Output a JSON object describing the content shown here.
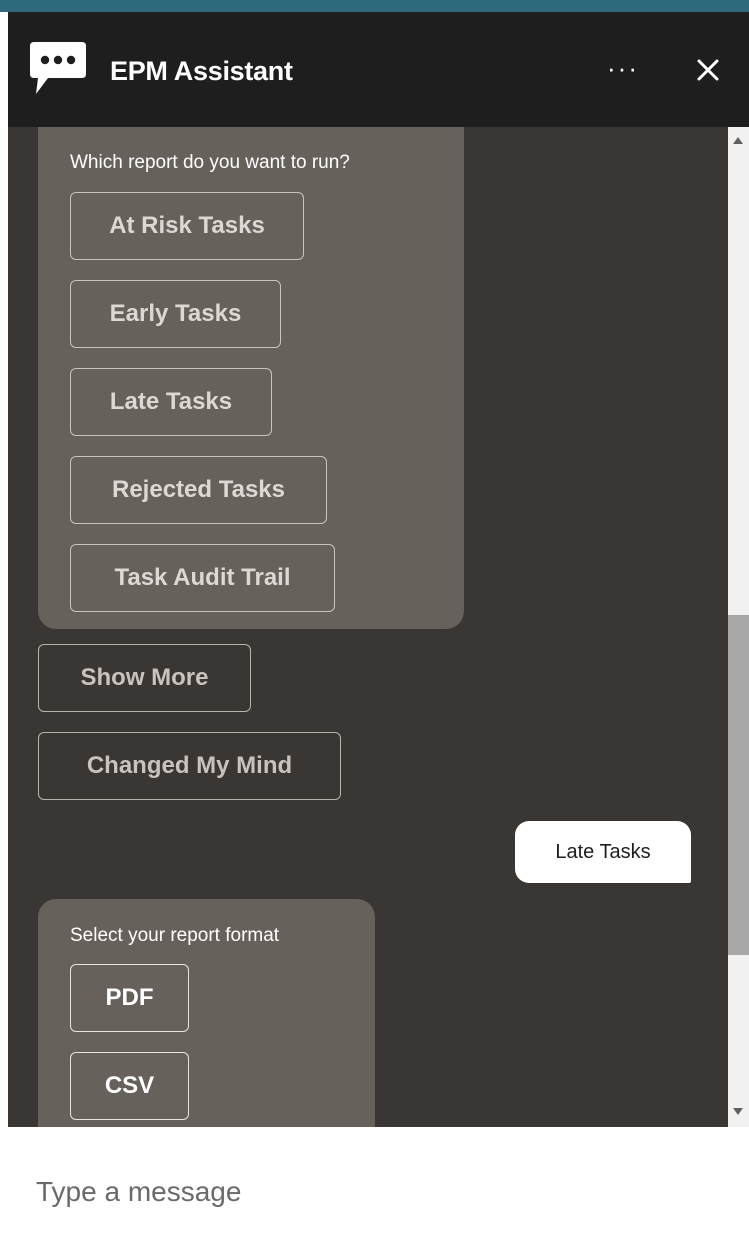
{
  "header": {
    "title": "EPM Assistant",
    "more_label": "···",
    "logo_icon": "chat-bubble-icon",
    "more_icon": "more-horizontal-icon",
    "close_icon": "close-icon"
  },
  "chat": {
    "report_prompt": {
      "text": "Which report do you want to run?",
      "options": [
        "At Risk Tasks",
        "Early Tasks",
        "Late Tasks",
        "Rejected Tasks",
        "Task Audit Trail"
      ]
    },
    "actions": {
      "show_more": "Show More",
      "changed_mind": "Changed My Mind"
    },
    "user_reply": "Late Tasks",
    "format_prompt": {
      "text": "Select your report format",
      "options": [
        "PDF",
        "CSV"
      ]
    }
  },
  "composer": {
    "placeholder": "Type a message"
  },
  "colors": {
    "header_bg": "#1e1e1e",
    "chat_bg": "#3a3633",
    "bot_bubble": "#67615c",
    "user_bubble": "#ffffff",
    "top_strip": "#2f6a7c"
  }
}
